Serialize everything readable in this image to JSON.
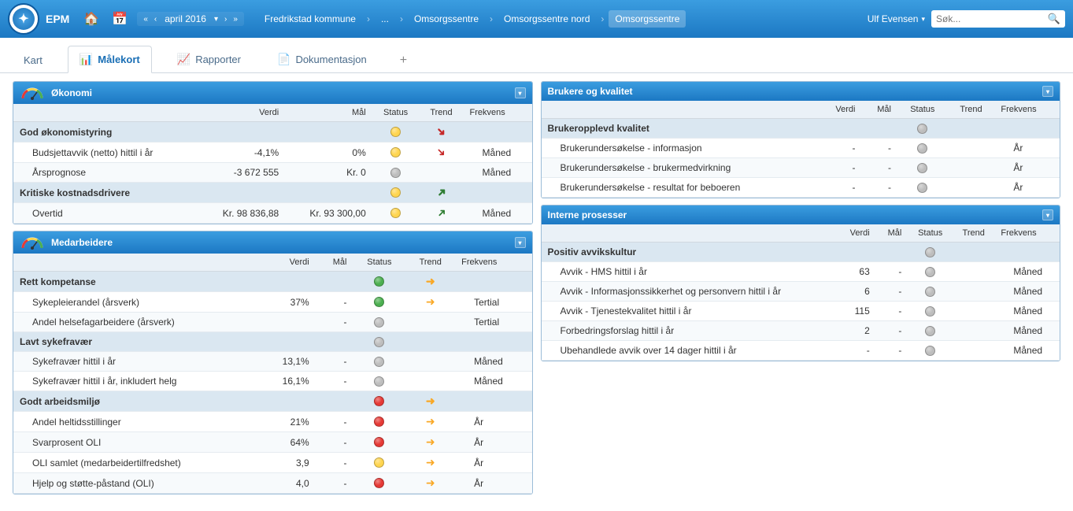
{
  "app": {
    "name": "EPM"
  },
  "date_nav": {
    "label": "april 2016"
  },
  "breadcrumb": {
    "items": [
      {
        "label": "Fredrikstad kommune"
      },
      {
        "label": "..."
      },
      {
        "label": "Omsorgssentre"
      },
      {
        "label": "Omsorgssentre nord"
      },
      {
        "label": "Omsorgssentre",
        "active": true
      }
    ]
  },
  "user": {
    "name": "Ulf Evensen"
  },
  "search": {
    "placeholder": "Søk..."
  },
  "tabs": {
    "kart": "Kart",
    "malekort": "Målekort",
    "rapporter": "Rapporter",
    "dokumentasjon": "Dokumentasjon"
  },
  "columns": {
    "verdi": "Verdi",
    "mal": "Mål",
    "status": "Status",
    "trend": "Trend",
    "frekvens": "Frekvens"
  },
  "panels": {
    "okonomi": {
      "title": "Økonomi",
      "groups": [
        {
          "label": "God økonomistyring",
          "status": "yellow",
          "trend": "down-red",
          "rows": [
            {
              "label": "Budsjettavvik (netto) hittil i år",
              "verdi": "-4,1%",
              "mal": "0%",
              "status": "yellow",
              "trend": "down-red",
              "frekvens": "Måned"
            },
            {
              "label": "Årsprognose",
              "verdi": "-3 672 555",
              "mal": "Kr. 0",
              "status": "gray",
              "trend": "",
              "frekvens": "Måned"
            }
          ]
        },
        {
          "label": "Kritiske kostnadsdrivere",
          "status": "yellow",
          "trend": "up-green",
          "rows": [
            {
              "label": "Overtid",
              "verdi": "Kr. 98 836,88",
              "mal": "Kr. 93 300,00",
              "status": "yellow",
              "trend": "up-green",
              "frekvens": "Måned"
            }
          ]
        }
      ]
    },
    "medarbeidere": {
      "title": "Medarbeidere",
      "groups": [
        {
          "label": "Rett kompetanse",
          "status": "green",
          "trend": "right-yellow",
          "rows": [
            {
              "label": "Sykepleierandel (årsverk)",
              "verdi": "37%",
              "mal": "-",
              "status": "green",
              "trend": "right-yellow",
              "frekvens": "Tertial"
            },
            {
              "label": "Andel helsefagarbeidere (årsverk)",
              "verdi": "",
              "mal": "-",
              "status": "gray",
              "trend": "",
              "frekvens": "Tertial"
            }
          ]
        },
        {
          "label": "Lavt sykefravær",
          "status": "gray",
          "trend": "",
          "rows": [
            {
              "label": "Sykefravær hittil i år",
              "verdi": "13,1%",
              "mal": "-",
              "status": "gray",
              "trend": "",
              "frekvens": "Måned"
            },
            {
              "label": "Sykefravær hittil i år, inkludert helg",
              "verdi": "16,1%",
              "mal": "-",
              "status": "gray",
              "trend": "",
              "frekvens": "Måned"
            }
          ]
        },
        {
          "label": "Godt arbeidsmiljø",
          "status": "red",
          "trend": "right-yellow",
          "rows": [
            {
              "label": "Andel heltidsstillinger",
              "verdi": "21%",
              "mal": "-",
              "status": "red",
              "trend": "right-yellow",
              "frekvens": "År"
            },
            {
              "label": "Svarprosent OLI",
              "verdi": "64%",
              "mal": "-",
              "status": "red",
              "trend": "right-yellow",
              "frekvens": "År"
            },
            {
              "label": "OLI samlet (medarbeidertilfredshet)",
              "verdi": "3,9",
              "mal": "-",
              "status": "yellow",
              "trend": "right-yellow",
              "frekvens": "År"
            },
            {
              "label": "Hjelp og støtte-påstand (OLI)",
              "verdi": "4,0",
              "mal": "-",
              "status": "red",
              "trend": "right-yellow",
              "frekvens": "År"
            }
          ]
        }
      ]
    },
    "brukere": {
      "title": "Brukere og kvalitet",
      "groups": [
        {
          "label": "Brukeropplevd kvalitet",
          "status": "gray",
          "trend": "",
          "rows": [
            {
              "label": "Brukerundersøkelse - informasjon",
              "verdi": "-",
              "mal": "-",
              "status": "gray",
              "trend": "",
              "frekvens": "År"
            },
            {
              "label": "Brukerundersøkelse - brukermedvirkning",
              "verdi": "-",
              "mal": "-",
              "status": "gray",
              "trend": "",
              "frekvens": "År"
            },
            {
              "label": "Brukerundersøkelse - resultat for beboeren",
              "verdi": "-",
              "mal": "-",
              "status": "gray",
              "trend": "",
              "frekvens": "År"
            }
          ]
        }
      ]
    },
    "interne": {
      "title": "Interne prosesser",
      "groups": [
        {
          "label": "Positiv avvikskultur",
          "status": "gray",
          "trend": "",
          "rows": [
            {
              "label": "Avvik - HMS hittil i år",
              "verdi": "63",
              "mal": "-",
              "status": "gray",
              "trend": "",
              "frekvens": "Måned"
            },
            {
              "label": "Avvik - Informasjonssikkerhet og personvern hittil i år",
              "verdi": "6",
              "mal": "-",
              "status": "gray",
              "trend": "",
              "frekvens": "Måned"
            },
            {
              "label": "Avvik - Tjenestekvalitet hittil i år",
              "verdi": "115",
              "mal": "-",
              "status": "gray",
              "trend": "",
              "frekvens": "Måned"
            },
            {
              "label": "Forbedringsforslag hittil i år",
              "verdi": "2",
              "mal": "-",
              "status": "gray",
              "trend": "",
              "frekvens": "Måned"
            },
            {
              "label": "Ubehandlede avvik over 14 dager hittil i år",
              "verdi": "-",
              "mal": "-",
              "status": "gray",
              "trend": "",
              "frekvens": "Måned"
            }
          ]
        }
      ]
    }
  }
}
